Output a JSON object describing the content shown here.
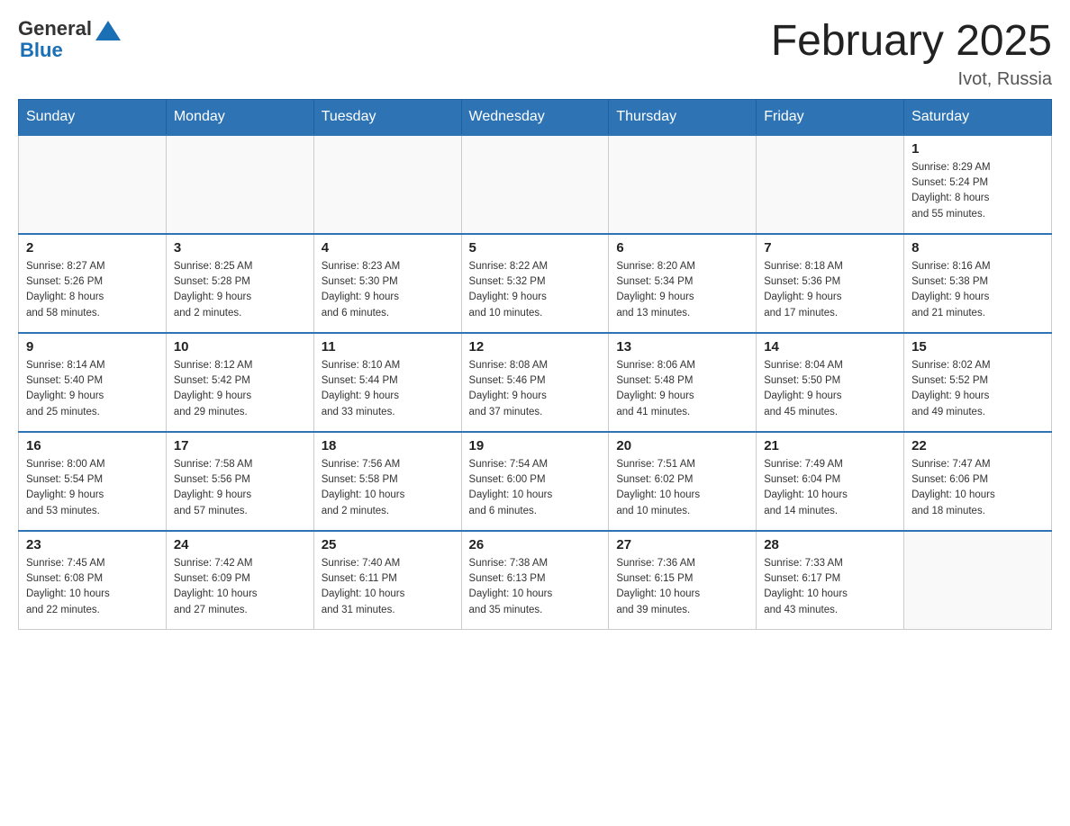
{
  "header": {
    "logo_general": "General",
    "logo_blue": "Blue",
    "month_title": "February 2025",
    "location": "Ivot, Russia"
  },
  "days_of_week": [
    "Sunday",
    "Monday",
    "Tuesday",
    "Wednesday",
    "Thursday",
    "Friday",
    "Saturday"
  ],
  "weeks": [
    [
      {
        "day": "",
        "info": ""
      },
      {
        "day": "",
        "info": ""
      },
      {
        "day": "",
        "info": ""
      },
      {
        "day": "",
        "info": ""
      },
      {
        "day": "",
        "info": ""
      },
      {
        "day": "",
        "info": ""
      },
      {
        "day": "1",
        "info": "Sunrise: 8:29 AM\nSunset: 5:24 PM\nDaylight: 8 hours\nand 55 minutes."
      }
    ],
    [
      {
        "day": "2",
        "info": "Sunrise: 8:27 AM\nSunset: 5:26 PM\nDaylight: 8 hours\nand 58 minutes."
      },
      {
        "day": "3",
        "info": "Sunrise: 8:25 AM\nSunset: 5:28 PM\nDaylight: 9 hours\nand 2 minutes."
      },
      {
        "day": "4",
        "info": "Sunrise: 8:23 AM\nSunset: 5:30 PM\nDaylight: 9 hours\nand 6 minutes."
      },
      {
        "day": "5",
        "info": "Sunrise: 8:22 AM\nSunset: 5:32 PM\nDaylight: 9 hours\nand 10 minutes."
      },
      {
        "day": "6",
        "info": "Sunrise: 8:20 AM\nSunset: 5:34 PM\nDaylight: 9 hours\nand 13 minutes."
      },
      {
        "day": "7",
        "info": "Sunrise: 8:18 AM\nSunset: 5:36 PM\nDaylight: 9 hours\nand 17 minutes."
      },
      {
        "day": "8",
        "info": "Sunrise: 8:16 AM\nSunset: 5:38 PM\nDaylight: 9 hours\nand 21 minutes."
      }
    ],
    [
      {
        "day": "9",
        "info": "Sunrise: 8:14 AM\nSunset: 5:40 PM\nDaylight: 9 hours\nand 25 minutes."
      },
      {
        "day": "10",
        "info": "Sunrise: 8:12 AM\nSunset: 5:42 PM\nDaylight: 9 hours\nand 29 minutes."
      },
      {
        "day": "11",
        "info": "Sunrise: 8:10 AM\nSunset: 5:44 PM\nDaylight: 9 hours\nand 33 minutes."
      },
      {
        "day": "12",
        "info": "Sunrise: 8:08 AM\nSunset: 5:46 PM\nDaylight: 9 hours\nand 37 minutes."
      },
      {
        "day": "13",
        "info": "Sunrise: 8:06 AM\nSunset: 5:48 PM\nDaylight: 9 hours\nand 41 minutes."
      },
      {
        "day": "14",
        "info": "Sunrise: 8:04 AM\nSunset: 5:50 PM\nDaylight: 9 hours\nand 45 minutes."
      },
      {
        "day": "15",
        "info": "Sunrise: 8:02 AM\nSunset: 5:52 PM\nDaylight: 9 hours\nand 49 minutes."
      }
    ],
    [
      {
        "day": "16",
        "info": "Sunrise: 8:00 AM\nSunset: 5:54 PM\nDaylight: 9 hours\nand 53 minutes."
      },
      {
        "day": "17",
        "info": "Sunrise: 7:58 AM\nSunset: 5:56 PM\nDaylight: 9 hours\nand 57 minutes."
      },
      {
        "day": "18",
        "info": "Sunrise: 7:56 AM\nSunset: 5:58 PM\nDaylight: 10 hours\nand 2 minutes."
      },
      {
        "day": "19",
        "info": "Sunrise: 7:54 AM\nSunset: 6:00 PM\nDaylight: 10 hours\nand 6 minutes."
      },
      {
        "day": "20",
        "info": "Sunrise: 7:51 AM\nSunset: 6:02 PM\nDaylight: 10 hours\nand 10 minutes."
      },
      {
        "day": "21",
        "info": "Sunrise: 7:49 AM\nSunset: 6:04 PM\nDaylight: 10 hours\nand 14 minutes."
      },
      {
        "day": "22",
        "info": "Sunrise: 7:47 AM\nSunset: 6:06 PM\nDaylight: 10 hours\nand 18 minutes."
      }
    ],
    [
      {
        "day": "23",
        "info": "Sunrise: 7:45 AM\nSunset: 6:08 PM\nDaylight: 10 hours\nand 22 minutes."
      },
      {
        "day": "24",
        "info": "Sunrise: 7:42 AM\nSunset: 6:09 PM\nDaylight: 10 hours\nand 27 minutes."
      },
      {
        "day": "25",
        "info": "Sunrise: 7:40 AM\nSunset: 6:11 PM\nDaylight: 10 hours\nand 31 minutes."
      },
      {
        "day": "26",
        "info": "Sunrise: 7:38 AM\nSunset: 6:13 PM\nDaylight: 10 hours\nand 35 minutes."
      },
      {
        "day": "27",
        "info": "Sunrise: 7:36 AM\nSunset: 6:15 PM\nDaylight: 10 hours\nand 39 minutes."
      },
      {
        "day": "28",
        "info": "Sunrise: 7:33 AM\nSunset: 6:17 PM\nDaylight: 10 hours\nand 43 minutes."
      },
      {
        "day": "",
        "info": ""
      }
    ]
  ]
}
